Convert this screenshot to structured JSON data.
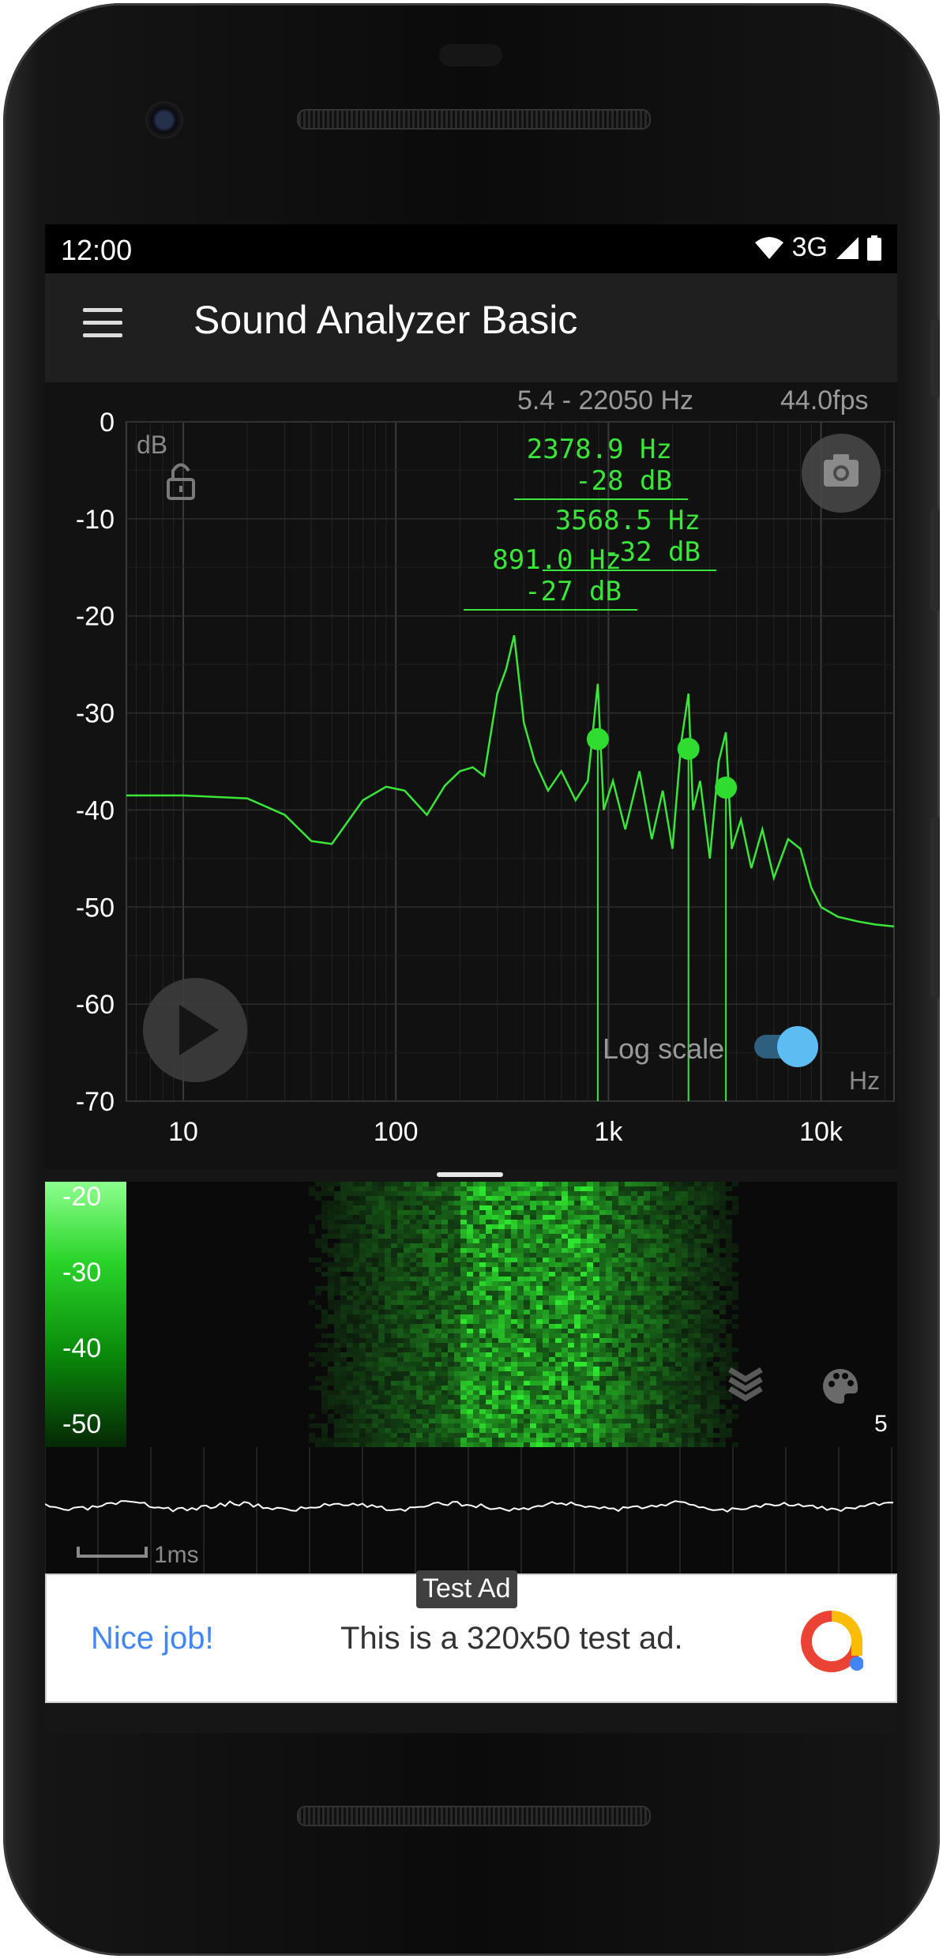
{
  "status_bar": {
    "time": "12:00",
    "network": "3G"
  },
  "app_bar": {
    "title": "Sound Analyzer Basic",
    "menu_icon": "menu-icon"
  },
  "spectrum": {
    "freq_range": "5.4 - 22050 Hz",
    "fps": "44.0fps",
    "y_unit": "dB",
    "x_unit": "Hz",
    "log_scale_label": "Log scale",
    "log_scale_on": true,
    "peak_labels": [
      {
        "freq": "2378.9 Hz",
        "db": "-28 dB"
      },
      {
        "freq": "3568.5 Hz",
        "db": "-32 dB"
      },
      {
        "freq": "891.0 Hz",
        "db": "-27 dB"
      }
    ]
  },
  "spectrogram": {
    "db_labels": [
      "-20",
      "-30",
      "-40",
      "-50"
    ],
    "count": "5"
  },
  "waveform": {
    "scale_label": "1ms"
  },
  "ad": {
    "badge": "Test Ad",
    "headline": "Nice job!",
    "text": "This is a 320x50 test ad."
  },
  "chart_data": {
    "type": "line",
    "title": "",
    "xlabel": "Hz",
    "ylabel": "dB",
    "xscale": "log",
    "xlim": [
      5.4,
      22050
    ],
    "ylim": [
      -70,
      0
    ],
    "x_tick_labels": [
      "10",
      "100",
      "1k",
      "10k"
    ],
    "x_ticks": [
      10,
      100,
      1000,
      10000
    ],
    "y_ticks": [
      0,
      -10,
      -20,
      -30,
      -40,
      -50,
      -60,
      -70
    ],
    "grid": true,
    "peaks": [
      {
        "x": 891.0,
        "y": -27
      },
      {
        "x": 2378.9,
        "y": -28
      },
      {
        "x": 3568.5,
        "y": -32
      }
    ],
    "series": [
      {
        "color": "#39e639",
        "x": [
          5.4,
          10,
          20,
          30,
          40,
          50,
          70,
          90,
          110,
          140,
          170,
          200,
          230,
          260,
          300,
          330,
          360,
          400,
          450,
          520,
          600,
          700,
          800,
          891,
          950,
          1050,
          1200,
          1400,
          1600,
          1800,
          2000,
          2200,
          2378.9,
          2500,
          2700,
          3000,
          3300,
          3568.5,
          3800,
          4200,
          4700,
          5300,
          6000,
          7000,
          8000,
          9000,
          10000,
          12000,
          15000,
          18000,
          22050
        ],
        "y": [
          -38.5,
          -38.5,
          -38.8,
          -40.5,
          -43.2,
          -43.5,
          -39,
          -37.6,
          -38,
          -40.5,
          -37.5,
          -36,
          -35.6,
          -36.5,
          -28,
          -25.5,
          -22,
          -31,
          -35,
          -38,
          -36,
          -39,
          -37,
          -27,
          -40,
          -37,
          -42,
          -36,
          -43,
          -38,
          -44,
          -33,
          -28,
          -40,
          -37,
          -45,
          -35,
          -32,
          -44,
          -41,
          -46,
          -42,
          -47,
          -43,
          -44,
          -48,
          -50,
          -51,
          -51.5,
          -51.8,
          -52
        ]
      }
    ]
  }
}
